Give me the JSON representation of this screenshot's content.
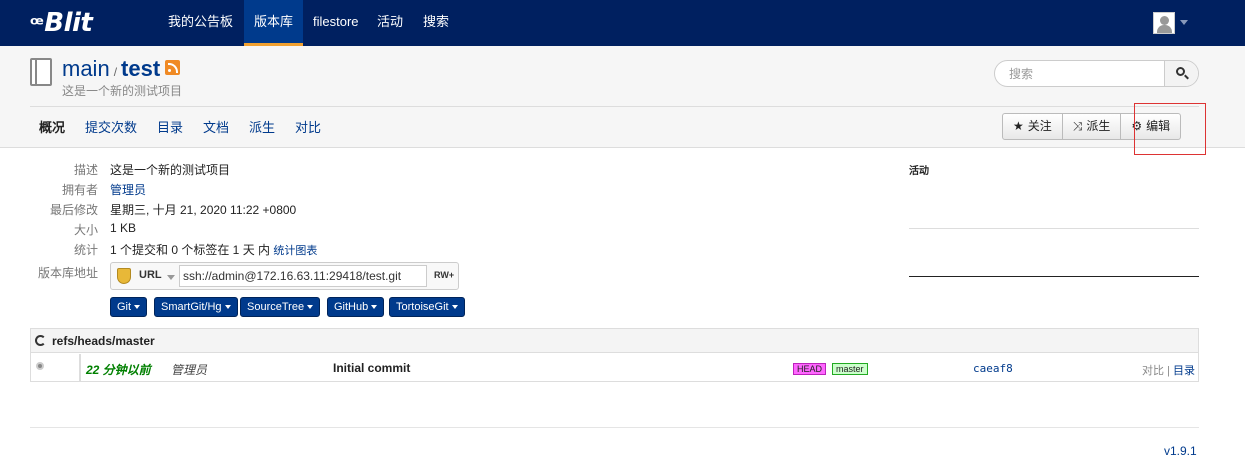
{
  "brand": {
    "logo_text": "Blit",
    "logo_prefix": "ꟹ"
  },
  "nav": {
    "items": [
      "我的公告板",
      "版本库",
      "filestore",
      "活动",
      "搜索"
    ],
    "active": "版本库"
  },
  "repo": {
    "project": "main",
    "separator": "/",
    "name": "test",
    "description": "这是一个新的测试项目"
  },
  "search": {
    "placeholder": "搜索"
  },
  "tabs": [
    "概况",
    "提交次数",
    "目录",
    "文档",
    "派生",
    "对比"
  ],
  "actions": {
    "watch": "关注",
    "fork": "派生",
    "edit": "编辑"
  },
  "summary": {
    "desc_label": "描述",
    "desc_value": "这是一个新的测试项目",
    "owner_label": "拥有者",
    "owner_value": "管理员",
    "modified_label": "最后修改",
    "modified_value": "星期三, 十月 21, 2020 11:22 +0800",
    "size_label": "大小",
    "size_value": "1 KB",
    "stats_label": "统计",
    "stats_value": "1 个提交和 0 个标签在 1 天 内",
    "stats_link": "统计图表",
    "url_label": "版本库地址",
    "url_protocol": "URL",
    "url_value": "ssh://admin@172.16.63.11:29418/test.git",
    "url_permission": "RW+"
  },
  "clients": [
    "Git",
    "SmartGit/Hg",
    "SourceTree",
    "GitHub",
    "TortoiseGit"
  ],
  "activity": {
    "title": "活动"
  },
  "branch": {
    "ref": "refs/heads/master",
    "commit": {
      "age": "22 分钟以前",
      "author": "管理员",
      "message": "Initial commit",
      "tags": [
        "HEAD",
        "master"
      ],
      "hash": "caeaf8",
      "link_compare": "对比",
      "link_sep": " | ",
      "link_tree": "目录"
    }
  },
  "footer": {
    "version": "v1.9.1"
  },
  "colors": {
    "navbar": "#002060",
    "accent": "#f0a030",
    "link": "#003a8c",
    "highlight_border": "#dd3333"
  }
}
